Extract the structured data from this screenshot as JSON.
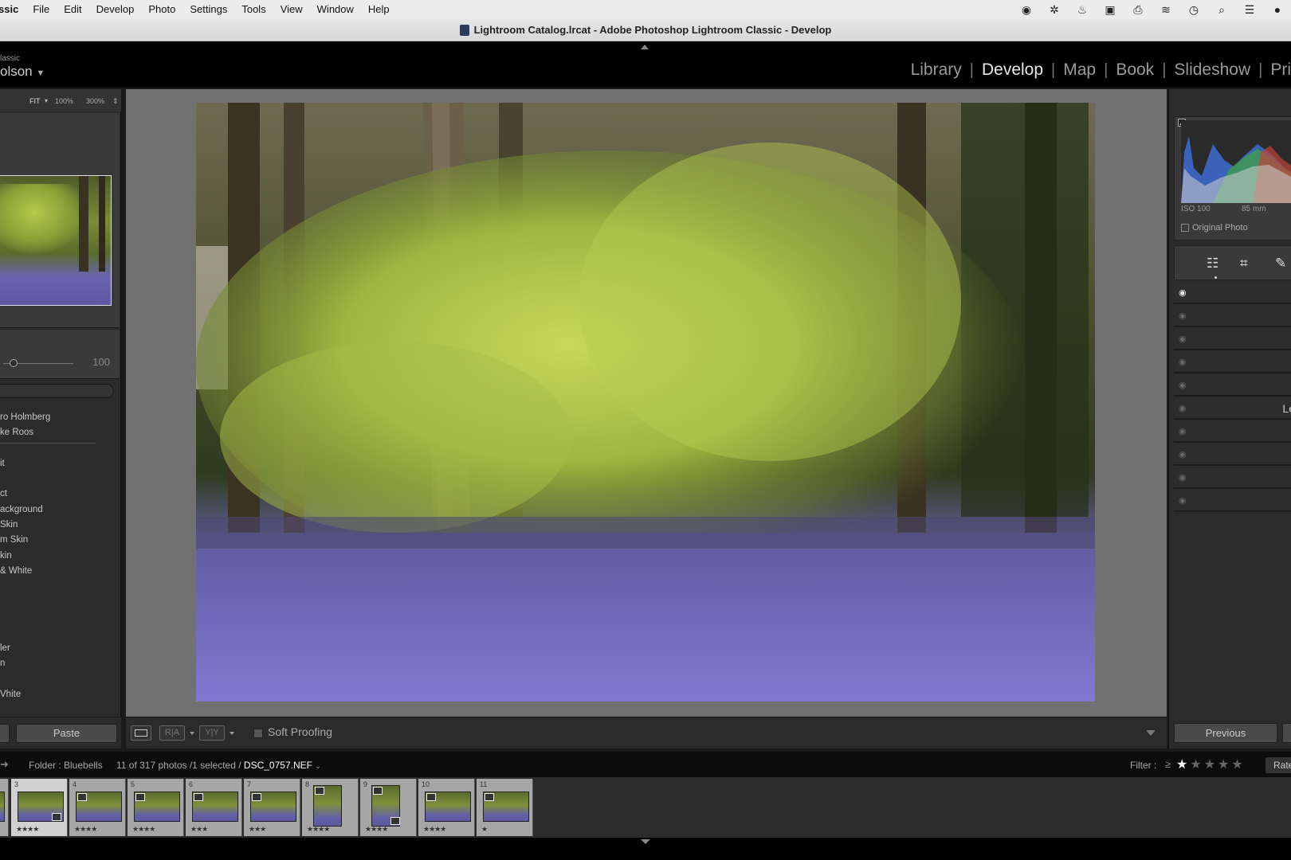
{
  "menubar": {
    "app_name": "ssic",
    "items": [
      "File",
      "Edit",
      "Develop",
      "Photo",
      "Settings",
      "Tools",
      "View",
      "Window",
      "Help"
    ],
    "tray_icons": [
      "search-assistant-icon",
      "butterfly-icon",
      "flame-icon",
      "display-icon",
      "printer-icon",
      "wifi-icon",
      "time-machine-icon",
      "spotlight-icon",
      "control-center-icon",
      "siri-icon"
    ]
  },
  "window": {
    "title": "Lightroom Catalog.lrcat - Adobe Photoshop Lightroom Classic - Develop"
  },
  "identity": {
    "line1": "lassic",
    "line2": "olson"
  },
  "modules": {
    "items": [
      "Library",
      "Develop",
      "Map",
      "Book",
      "Slideshow",
      "Pri"
    ],
    "active": "Develop"
  },
  "navigator": {
    "zoom_options": [
      "FIT",
      "100%",
      "300%"
    ]
  },
  "size_slider": {
    "value": "100"
  },
  "presets": {
    "items": [
      "ro Holmberg",
      "ke Roos",
      "it",
      "ct",
      "ackground",
      "Skin",
      "m Skin",
      "kin",
      "& White",
      "ler",
      "n",
      "Vhite"
    ]
  },
  "left_bottom": {
    "paste_label": "Paste"
  },
  "toolbar": {
    "soft_proofing_label": "Soft Proofing",
    "ra_label": "R|A",
    "yy_label": "Y|Y"
  },
  "histogram": {
    "iso": "ISO 100",
    "focal": "85 mm",
    "original_label": "Original Photo"
  },
  "masks": {
    "partial_label": "Le"
  },
  "right_bottom": {
    "previous_label": "Previous"
  },
  "filmstrip_bar": {
    "folder": "Folder : Bluebells",
    "count": "11 of 317 photos /1 selected /",
    "filename": "DSC_0757.NEF",
    "filter_label": "Filter :",
    "rating_op": "≥",
    "stars": "★★★★★",
    "filter_min_stars": 1,
    "rated_label": "Rate"
  },
  "filmstrip": {
    "cells": [
      {
        "num": "",
        "stars": "",
        "portrait": false
      },
      {
        "num": "3",
        "stars": "★★★★",
        "portrait": false
      },
      {
        "num": "4",
        "stars": "★★★★",
        "portrait": false
      },
      {
        "num": "5",
        "stars": "★★★★",
        "portrait": false
      },
      {
        "num": "6",
        "stars": "★★★",
        "portrait": false
      },
      {
        "num": "7",
        "stars": "★★★",
        "portrait": false
      },
      {
        "num": "8",
        "stars": "★★★★",
        "portrait": true
      },
      {
        "num": "9",
        "stars": "★★★★",
        "portrait": true
      },
      {
        "num": "10",
        "stars": "★★★★",
        "portrait": false
      },
      {
        "num": "11",
        "stars": "★",
        "portrait": false
      }
    ],
    "selected_index": 1
  }
}
